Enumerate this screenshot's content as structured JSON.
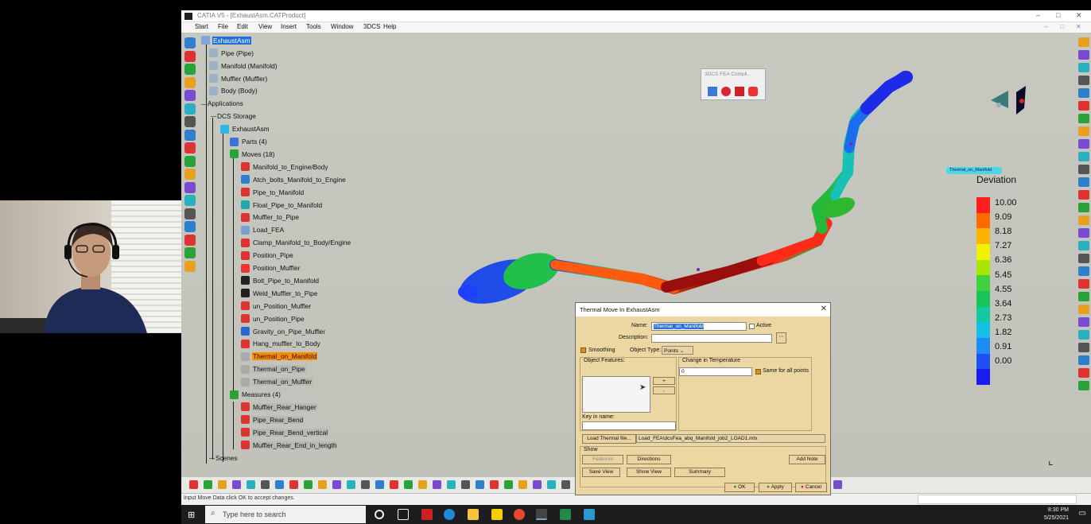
{
  "window": {
    "title": "CATIA V5 - [ExhaustAsm.CATProduct]",
    "min": "–",
    "max": "□",
    "close": "✕"
  },
  "menu": [
    "Start",
    "File",
    "Edit",
    "View",
    "Insert",
    "Tools",
    "Window",
    "3DCS",
    "Help"
  ],
  "tree": {
    "root": "ExhaustAsm",
    "parts": [
      "Pipe (Pipe)",
      "Manifold (Manifold)",
      "Muffler (Muffler)",
      "Body (Body)"
    ],
    "applications": "Applications",
    "dcs_storage": "DCS Storage",
    "dcs_asm": "ExhaustAsm",
    "parts_group": "Parts (4)",
    "moves_group": "Moves (18)",
    "moves": [
      "Manifold_to_Engine/Body",
      "Atch_bolts_Manifold_to_Engine",
      "Pipe_to_Manifold",
      "Float_Pipe_to_Manifold",
      "Muffler_to_Pipe",
      "Load_FEA",
      "Clamp_Manifold_to_Body/Engine",
      "Position_Pipe",
      "Position_Muffler",
      "Bolt_Pipe_to_Manifold",
      "Weld_Muffler_to_Pipe",
      "un_Position_Muffler",
      "un_Position_Pipe",
      "Gravity_on_Pipe_Muffler",
      "Hang_muffler_to_Body",
      "Thermal_on_Manifold",
      "Thermal_on_Pipe",
      "Thermal_on_Muffler"
    ],
    "measures_group": "Measures (4)",
    "measures": [
      "Muffler_Rear_Hanger",
      "Pipe_Rear_Bend",
      "Pipe_Rear_Bend_vertical",
      "Muffler_Rear_End_in_length"
    ],
    "scenes": "Scenes"
  },
  "fea_toolbar": {
    "title": "3DCS FEA Compli..."
  },
  "tag_label": "Thermal_on_Manifold",
  "legend": {
    "title": "Deviation",
    "values": [
      "10.00",
      "9.09",
      "8.18",
      "7.27",
      "6.36",
      "5.45",
      "4.55",
      "3.64",
      "2.73",
      "1.82",
      "0.91",
      "0.00"
    ],
    "colors": [
      "#ff1f1f",
      "#ff6a00",
      "#ffb300",
      "#f2f200",
      "#a8e600",
      "#3fd13f",
      "#17c45a",
      "#14c9a0",
      "#16bfe6",
      "#1d8cf5",
      "#1f4ff5",
      "#1b1bf0"
    ]
  },
  "dialog": {
    "title": "Thermal Move In ExhaustAsm",
    "name_label": "Name:",
    "name_value": "Thermal_on_Manifold",
    "active_label": "Active",
    "description_label": "Description:",
    "description_value": "",
    "smoothing_label": "Smoothing",
    "object_type_label": "Object Type:",
    "object_type_value": "Points",
    "object_features_label": "Object Features:",
    "change_temp_label": "Change in Temperature",
    "temp_value": "0",
    "same_for_all_label": "Same for all points",
    "plus": "+",
    "minus": "-",
    "key_in_name_label": "Key in name:",
    "load_thermal_label": "Load Thermal file...",
    "thermal_file_value": "Load_FEA\\dcsFea_abq_Manifold_job2_LOAD1.mtx",
    "show_label": "Show",
    "show_buttons": [
      "Features",
      "Directions"
    ],
    "add_note_label": "Add Note",
    "save_view_label": "Save View",
    "show_view_label": "Show View",
    "summary_label": "Summary",
    "ok_label": "OK",
    "apply_label": "Apply",
    "cancel_label": "Cancel"
  },
  "status": {
    "message": "Input Move Data click OK to accept changes."
  },
  "taskbar": {
    "search_placeholder": "Type here to search",
    "time": "8:30 PM",
    "date": "5/25/2021"
  }
}
